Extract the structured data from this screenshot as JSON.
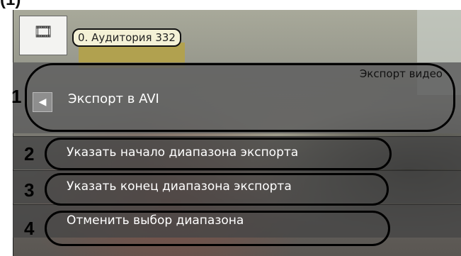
{
  "heading": "(1)",
  "camera": {
    "label": "0. Аудитория 332",
    "thumbnail_icon": "film-strip-icon"
  },
  "menu": {
    "title": "Экспорт видео",
    "back_icon": "◀",
    "primary_item": "Экспорт в AVI",
    "items": [
      "Указать начало диапазона экспорта",
      "Указать конец диапазона экспорта",
      "Отменить выбор диапазона"
    ]
  },
  "callouts": [
    "1",
    "2",
    "3",
    "4"
  ]
}
